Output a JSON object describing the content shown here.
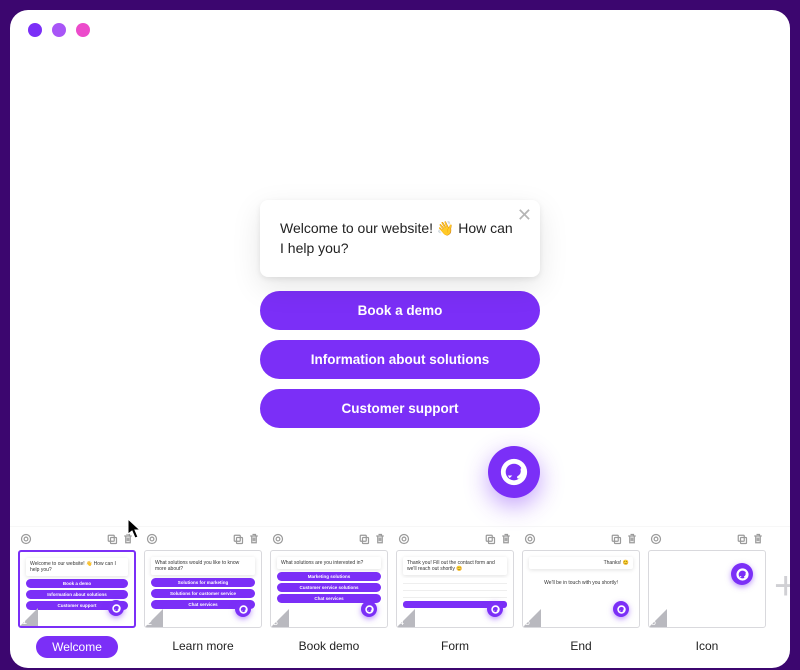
{
  "colors": {
    "accent": "#7B2FF7",
    "bg": "#3C066F"
  },
  "chat": {
    "message": "Welcome to our website! 👋 How can I help you?",
    "options": [
      "Book a demo",
      "Information about solutions",
      "Customer support"
    ]
  },
  "slides": [
    {
      "number": "1",
      "label": "Welcome",
      "active": true,
      "preview_type": "welcome",
      "text": "Welcome to our website! 👋 How can I help you?",
      "buttons": [
        "Book a demo",
        "Information about solutions",
        "Customer support"
      ]
    },
    {
      "number": "2",
      "label": "Learn more",
      "active": false,
      "preview_type": "options",
      "text": "What solutions would you like to know more about?",
      "buttons": [
        "Solutions for marketing",
        "Solutions for customer service",
        "Chat services"
      ]
    },
    {
      "number": "3",
      "label": "Book demo",
      "active": false,
      "preview_type": "options",
      "text": "What solutions are you interested in?",
      "buttons": [
        "Marketing solutions",
        "Customer service solutions",
        "Chat services"
      ]
    },
    {
      "number": "4",
      "label": "Form",
      "active": false,
      "preview_type": "form",
      "text": "Thank you! Fill out the contact form and we'll reach out shortly 😊"
    },
    {
      "number": "5",
      "label": "End",
      "active": false,
      "preview_type": "end",
      "text": "Thanks! 😊",
      "subtext": "We'll be in touch with you shortly!"
    },
    {
      "number": "6",
      "label": "Icon",
      "active": false,
      "preview_type": "icon"
    }
  ],
  "toolbar_icons": {
    "target": "target-icon",
    "duplicate": "duplicate-icon",
    "delete": "trash-icon"
  }
}
